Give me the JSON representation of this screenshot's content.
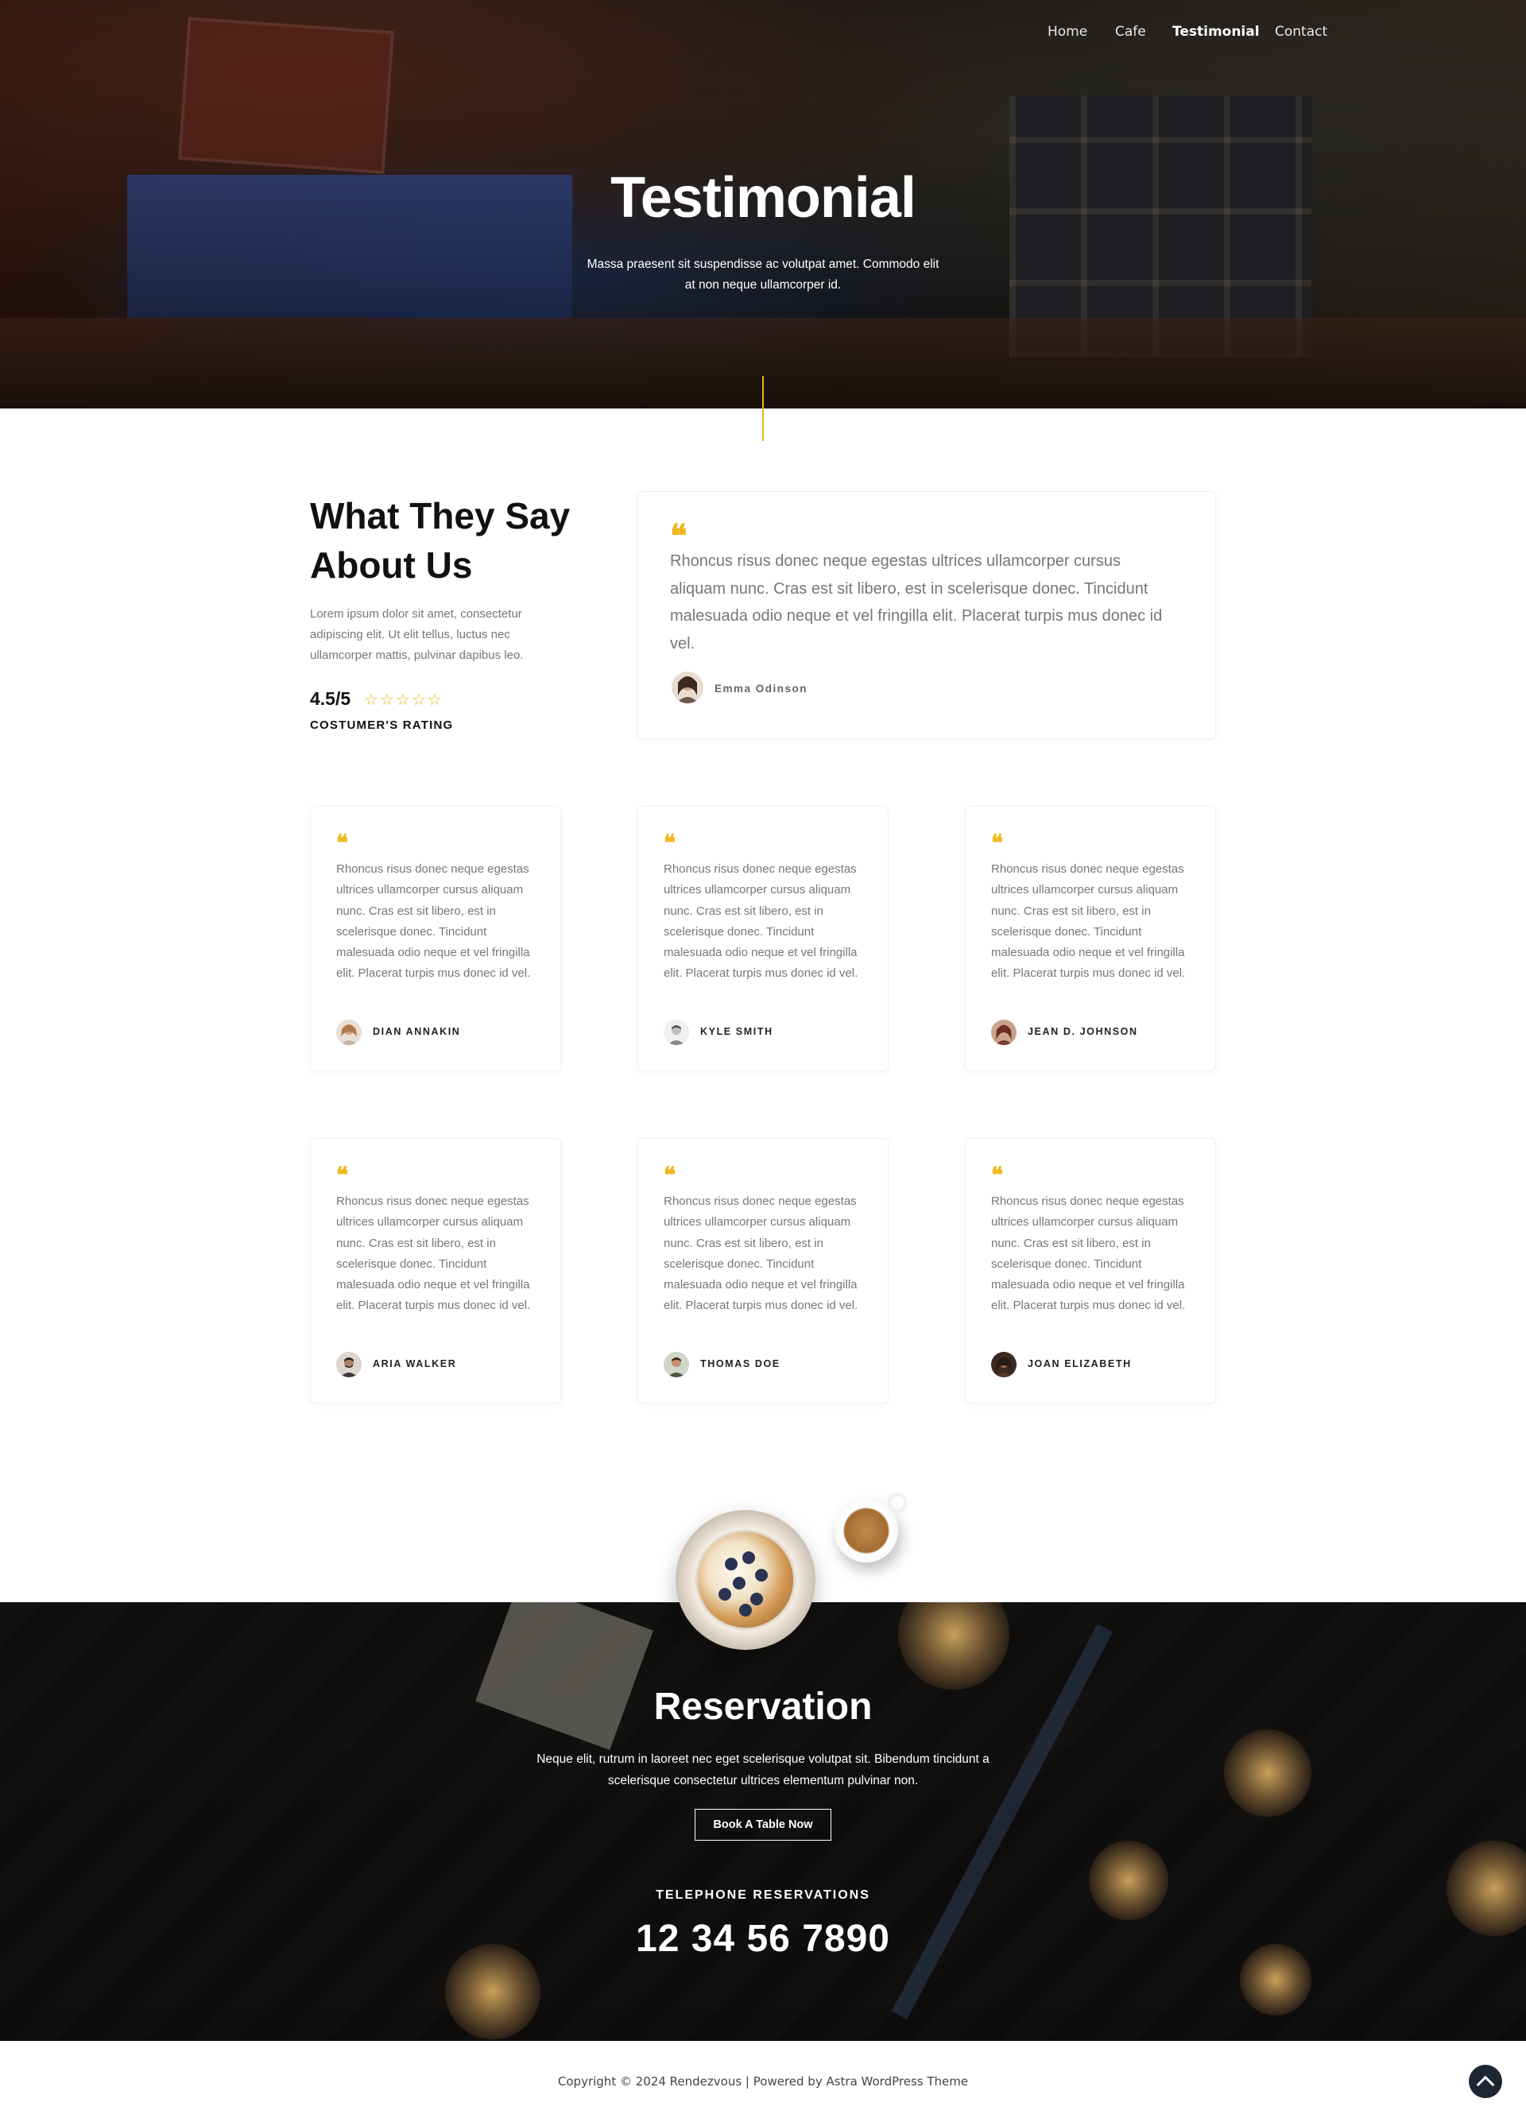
{
  "nav": {
    "items": [
      {
        "label": "Home"
      },
      {
        "label": "Cafe"
      },
      {
        "label": "Testimonial",
        "active": true
      },
      {
        "label": "Contact"
      }
    ]
  },
  "hero": {
    "title": "Testimonial",
    "subtitle": "Massa praesent sit suspendisse ac volutpat amet. Commodo elit at non neque ullamcorper id."
  },
  "intro": {
    "title": "What They Say About Us",
    "text": "Lorem ipsum dolor sit amet, consectetur adipiscing elit. Ut elit tellus, luctus nec ullamcorper mattis, pulvinar dapibus leo.",
    "rating": "4.5/5",
    "rating_value": 4.5,
    "rating_max": 5,
    "stars": "☆☆☆☆☆",
    "rating_label": "COSTUMER'S RATING"
  },
  "featured": {
    "quote_mark": "❝",
    "text": "Rhoncus risus donec neque egestas ultrices ullamcorper cursus aliquam nunc. Cras est sit libero, est in scelerisque donec. Tincidunt malesuada odio neque et vel fringilla elit. Placerat turpis mus donec id vel.",
    "name": "Emma Odinson"
  },
  "testimonials": [
    {
      "quote_mark": "❝",
      "text": "Rhoncus risus donec neque egestas ultrices ullamcorper cursus aliquam nunc. Cras est sit libero, est in scelerisque donec. Tincidunt malesuada odio neque et vel fringilla elit. Placerat turpis mus donec id vel.",
      "name": "DIAN ANNAKIN"
    },
    {
      "quote_mark": "❝",
      "text": "Rhoncus risus donec neque egestas ultrices ullamcorper cursus aliquam nunc. Cras est sit libero, est in scelerisque donec. Tincidunt malesuada odio neque et vel fringilla elit. Placerat turpis mus donec id vel.",
      "name": "KYLE SMITH"
    },
    {
      "quote_mark": "❝",
      "text": "Rhoncus risus donec neque egestas ultrices ullamcorper cursus aliquam nunc. Cras est sit libero, est in scelerisque donec. Tincidunt malesuada odio neque et vel fringilla elit. Placerat turpis mus donec id vel.",
      "name": "JEAN D. JOHNSON"
    },
    {
      "quote_mark": "❝",
      "text": "Rhoncus risus donec neque egestas ultrices ullamcorper cursus aliquam nunc. Cras est sit libero, est in scelerisque donec. Tincidunt malesuada odio neque et vel fringilla elit. Placerat turpis mus donec id vel.",
      "name": "ARIA WALKER"
    },
    {
      "quote_mark": "❝",
      "text": "Rhoncus risus donec neque egestas ultrices ullamcorper cursus aliquam nunc. Cras est sit libero, est in scelerisque donec. Tincidunt malesuada odio neque et vel fringilla elit. Placerat turpis mus donec id vel.",
      "name": "THOMAS DOE"
    },
    {
      "quote_mark": "❝",
      "text": "Rhoncus risus donec neque egestas ultrices ullamcorper cursus aliquam nunc. Cras est sit libero, est in scelerisque donec. Tincidunt malesuada odio neque et vel fringilla elit. Placerat turpis mus donec id vel.",
      "name": "JOAN ELIZABETH"
    }
  ],
  "reservation": {
    "title": "Reservation",
    "subtitle": "Neque elit, rutrum in laoreet nec eget scelerisque volutpat sit. Bibendum tincidunt a scelerisque consectetur ultrices elementum pulvinar non.",
    "button_label": "Book A Table Now",
    "tel_label": "TELEPHONE RESERVATIONS",
    "tel_number": "12 34 56 7890"
  },
  "footer": {
    "copyright": "Copyright © 2024 Rendezvous | Powered by Astra WordPress Theme"
  },
  "icons": {
    "scroll_top": "chevron-up-icon",
    "quote": "quote-icon",
    "star": "star-outline-icon"
  },
  "colors": {
    "accent": "#f0b921",
    "dark": "#1d2633",
    "text_muted": "#777777"
  }
}
